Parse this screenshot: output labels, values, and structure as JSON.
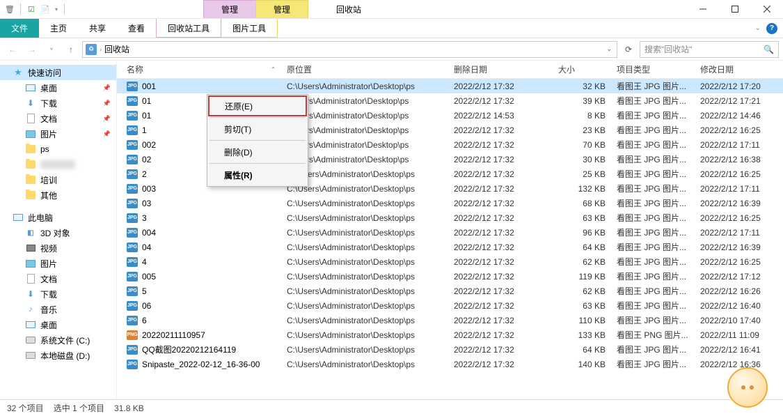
{
  "title": "回收站",
  "tab_manage1": "管理",
  "tab_manage2": "管理",
  "ribbon": {
    "file": "文件",
    "home": "主页",
    "share": "共享",
    "view": "查看",
    "tool1": "回收站工具",
    "tool2": "图片工具"
  },
  "breadcrumb": {
    "root": "回收站"
  },
  "search_placeholder": "搜索\"回收站\"",
  "nav": {
    "quick_access": "快速访问",
    "desktop": "桌面",
    "downloads": "下载",
    "documents": "文档",
    "pictures": "图片",
    "ps": "ps",
    "blank": " ",
    "training": "培训",
    "other": "其他",
    "this_pc": "此电脑",
    "objects_3d": "3D 对象",
    "videos": "视频",
    "pictures2": "图片",
    "documents2": "文档",
    "downloads2": "下载",
    "music": "音乐",
    "desktop2": "桌面",
    "sys_drive": "系统文件 (C:)",
    "local_drive": "本地磁盘 (D:)"
  },
  "columns": {
    "name": "名称",
    "original": "原位置",
    "del_date": "删除日期",
    "size": "大小",
    "kind": "项目类型",
    "mod_date": "修改日期"
  },
  "context_menu": {
    "restore": "还原(E)",
    "cut": "剪切(T)",
    "delete": "删除(D)",
    "properties": "属性(R)"
  },
  "files": [
    {
      "name": "001",
      "orig": "C:\\Users\\Administrator\\Desktop\\ps",
      "ddate": "2022/2/12 17:32",
      "size": "32 KB",
      "kind": "看图王 JPG 图片...",
      "mdate": "2022/2/12 17:20",
      "type": "jpg",
      "selected": true
    },
    {
      "name": "01",
      "orig": "\\\\Users\\Administrator\\Desktop\\ps",
      "ddate": "2022/2/12 17:32",
      "size": "39 KB",
      "kind": "看图王 JPG 图片...",
      "mdate": "2022/2/12 17:21",
      "type": "jpg"
    },
    {
      "name": "01",
      "orig": "\\\\Users\\Administrator\\Desktop\\ps",
      "ddate": "2022/2/12 14:53",
      "size": "8 KB",
      "kind": "看图王 JPG 图片...",
      "mdate": "2022/2/12 14:46",
      "type": "jpg"
    },
    {
      "name": "1",
      "orig": "\\\\Users\\Administrator\\Desktop\\ps",
      "ddate": "2022/2/12 17:32",
      "size": "23 KB",
      "kind": "看图王 JPG 图片...",
      "mdate": "2022/2/12 16:25",
      "type": "jpg"
    },
    {
      "name": "002",
      "orig": "\\\\Users\\Administrator\\Desktop\\ps",
      "ddate": "2022/2/12 17:32",
      "size": "70 KB",
      "kind": "看图王 JPG 图片...",
      "mdate": "2022/2/12 17:11",
      "type": "jpg"
    },
    {
      "name": "02",
      "orig": "\\\\Users\\Administrator\\Desktop\\ps",
      "ddate": "2022/2/12 17:32",
      "size": "30 KB",
      "kind": "看图王 JPG 图片...",
      "mdate": "2022/2/12 16:38",
      "type": "jpg"
    },
    {
      "name": "2",
      "orig": "C:\\Users\\Administrator\\Desktop\\ps",
      "ddate": "2022/2/12 17:32",
      "size": "25 KB",
      "kind": "看图王 JPG 图片...",
      "mdate": "2022/2/12 16:25",
      "type": "jpg"
    },
    {
      "name": "003",
      "orig": "C:\\Users\\Administrator\\Desktop\\ps",
      "ddate": "2022/2/12 17:32",
      "size": "132 KB",
      "kind": "看图王 JPG 图片...",
      "mdate": "2022/2/12 17:11",
      "type": "jpg"
    },
    {
      "name": "03",
      "orig": "C:\\Users\\Administrator\\Desktop\\ps",
      "ddate": "2022/2/12 17:32",
      "size": "68 KB",
      "kind": "看图王 JPG 图片...",
      "mdate": "2022/2/12 16:39",
      "type": "jpg"
    },
    {
      "name": "3",
      "orig": "C:\\Users\\Administrator\\Desktop\\ps",
      "ddate": "2022/2/12 17:32",
      "size": "63 KB",
      "kind": "看图王 JPG 图片...",
      "mdate": "2022/2/12 16:25",
      "type": "jpg"
    },
    {
      "name": "004",
      "orig": "C:\\Users\\Administrator\\Desktop\\ps",
      "ddate": "2022/2/12 17:32",
      "size": "96 KB",
      "kind": "看图王 JPG 图片...",
      "mdate": "2022/2/12 17:11",
      "type": "jpg"
    },
    {
      "name": "04",
      "orig": "C:\\Users\\Administrator\\Desktop\\ps",
      "ddate": "2022/2/12 17:32",
      "size": "64 KB",
      "kind": "看图王 JPG 图片...",
      "mdate": "2022/2/12 16:39",
      "type": "jpg"
    },
    {
      "name": "4",
      "orig": "C:\\Users\\Administrator\\Desktop\\ps",
      "ddate": "2022/2/12 17:32",
      "size": "62 KB",
      "kind": "看图王 JPG 图片...",
      "mdate": "2022/2/12 16:25",
      "type": "jpg"
    },
    {
      "name": "005",
      "orig": "C:\\Users\\Administrator\\Desktop\\ps",
      "ddate": "2022/2/12 17:32",
      "size": "119 KB",
      "kind": "看图王 JPG 图片...",
      "mdate": "2022/2/12 17:12",
      "type": "jpg"
    },
    {
      "name": "5",
      "orig": "C:\\Users\\Administrator\\Desktop\\ps",
      "ddate": "2022/2/12 17:32",
      "size": "62 KB",
      "kind": "看图王 JPG 图片...",
      "mdate": "2022/2/12 16:26",
      "type": "jpg"
    },
    {
      "name": "06",
      "orig": "C:\\Users\\Administrator\\Desktop\\ps",
      "ddate": "2022/2/12 17:32",
      "size": "63 KB",
      "kind": "看图王 JPG 图片...",
      "mdate": "2022/2/12 16:40",
      "type": "jpg"
    },
    {
      "name": "6",
      "orig": "C:\\Users\\Administrator\\Desktop\\ps",
      "ddate": "2022/2/12 17:32",
      "size": "110 KB",
      "kind": "看图王 JPG 图片...",
      "mdate": "2022/2/10 17:40",
      "type": "jpg"
    },
    {
      "name": "20220211110957",
      "orig": "C:\\Users\\Administrator\\Desktop\\ps",
      "ddate": "2022/2/12 17:32",
      "size": "133 KB",
      "kind": "看图王 PNG 图片...",
      "mdate": "2022/2/11 11:09",
      "type": "png"
    },
    {
      "name": "QQ截图20220212164119",
      "orig": "C:\\Users\\Administrator\\Desktop\\ps",
      "ddate": "2022/2/12 17:32",
      "size": "64 KB",
      "kind": "看图王 JPG 图片...",
      "mdate": "2022/2/12 16:41",
      "type": "jpg"
    },
    {
      "name": "Snipaste_2022-02-12_16-36-00",
      "orig": "C:\\Users\\Administrator\\Desktop\\ps",
      "ddate": "2022/2/12 17:32",
      "size": "140 KB",
      "kind": "看图王 JPG 图片...",
      "mdate": "2022/2/12 16:36",
      "type": "jpg"
    }
  ],
  "status": {
    "count": "32 个项目",
    "selected": "选中 1 个项目",
    "size": "31.8 KB"
  }
}
